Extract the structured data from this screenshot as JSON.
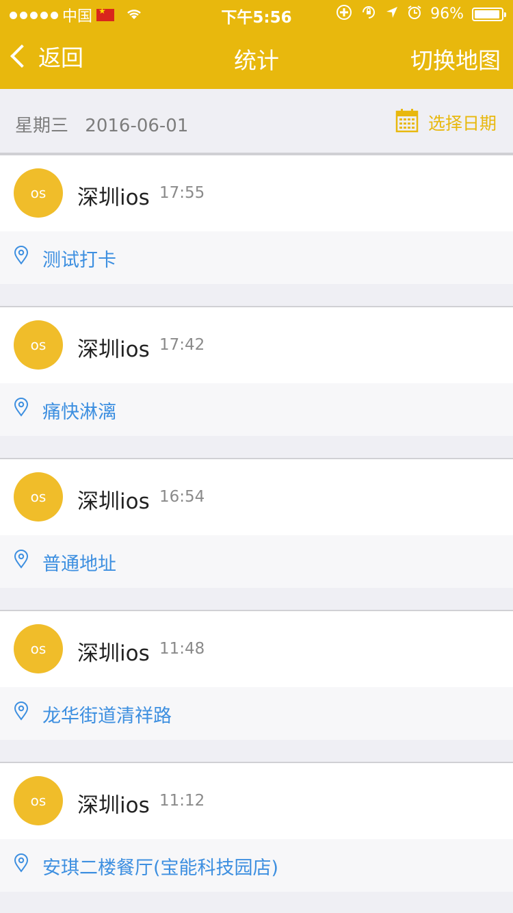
{
  "status_bar": {
    "carrier": "中国",
    "time": "下午5:56",
    "battery_text": "96%",
    "battery_level": 0.96
  },
  "nav": {
    "back_label": "返回",
    "title": "统计",
    "right_label": "切换地图"
  },
  "date_bar": {
    "weekday": "星期三",
    "date": "2016-06-01",
    "pick_label": "选择日期"
  },
  "records": [
    {
      "avatar": "os",
      "name": "深圳ios",
      "time": "17:55",
      "address": "测试打卡"
    },
    {
      "avatar": "os",
      "name": "深圳ios",
      "time": "17:42",
      "address": "痛快淋漓"
    },
    {
      "avatar": "os",
      "name": "深圳ios",
      "time": "16:54",
      "address": "普通地址"
    },
    {
      "avatar": "os",
      "name": "深圳ios",
      "time": "11:48",
      "address": "龙华街道清祥路"
    },
    {
      "avatar": "os",
      "name": "深圳ios",
      "time": "11:12",
      "address": "安琪二楼餐厅(宝能科技园店)"
    }
  ],
  "colors": {
    "accent": "#e8b80d",
    "avatar": "#f0bd2a",
    "link": "#3d8fe0",
    "background": "#efeff4"
  },
  "icons": [
    "signal-dots-icon",
    "china-flag-icon",
    "wifi-icon",
    "add-circle-icon",
    "rotation-lock-icon",
    "location-arrow-icon",
    "alarm-icon",
    "battery-icon",
    "back-chevron-icon",
    "calendar-icon",
    "location-pin-icon"
  ]
}
